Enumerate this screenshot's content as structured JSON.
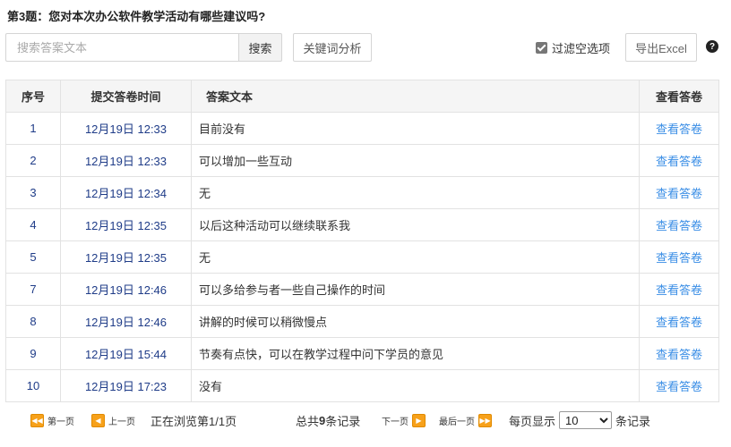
{
  "question": {
    "title": "第3题：您对本次办公软件教学活动有哪些建议吗?"
  },
  "toolbar": {
    "search_placeholder": "搜索答案文本",
    "search_label": "搜索",
    "keyword_label": "关键词分析",
    "filter_label": "过滤空选项",
    "filter_checked": true,
    "export_label": "导出Excel",
    "help_glyph": "?"
  },
  "table": {
    "headers": {
      "idx": "序号",
      "time": "提交答卷时间",
      "answer": "答案文本",
      "view": "查看答卷"
    },
    "rows": [
      {
        "idx": "1",
        "time": "12月19日 12:33",
        "answer": "目前没有",
        "view": "查看答卷"
      },
      {
        "idx": "2",
        "time": "12月19日 12:33",
        "answer": "可以增加一些互动",
        "view": "查看答卷"
      },
      {
        "idx": "3",
        "time": "12月19日 12:34",
        "answer": "无",
        "view": "查看答卷"
      },
      {
        "idx": "4",
        "time": "12月19日 12:35",
        "answer": "以后这种活动可以继续联系我",
        "view": "查看答卷"
      },
      {
        "idx": "5",
        "time": "12月19日 12:35",
        "answer": "无",
        "view": "查看答卷"
      },
      {
        "idx": "7",
        "time": "12月19日 12:46",
        "answer": "可以多给参与者一些自己操作的时间",
        "view": "查看答卷"
      },
      {
        "idx": "8",
        "time": "12月19日 12:46",
        "answer": "讲解的时候可以稍微慢点",
        "view": "查看答卷"
      },
      {
        "idx": "9",
        "time": "12月19日 15:44",
        "answer": "节奏有点快，可以在教学过程中问下学员的意见",
        "view": "查看答卷"
      },
      {
        "idx": "10",
        "time": "12月19日 17:23",
        "answer": "没有",
        "view": "查看答卷"
      }
    ]
  },
  "pager": {
    "first": "第一页",
    "prev": "上一页",
    "status": "正在浏览第1/1页",
    "total_prefix": "总共",
    "total_count": "9",
    "total_suffix": "条记录",
    "next": "下一页",
    "last": "最后一页",
    "per_page_label": "每页显示",
    "per_page_value": "10",
    "per_page_suffix": "条记录"
  },
  "colors": {
    "accent_link": "#3a8ee6",
    "pager_icon": "#f7a11a",
    "index_text": "#1f3c88"
  }
}
